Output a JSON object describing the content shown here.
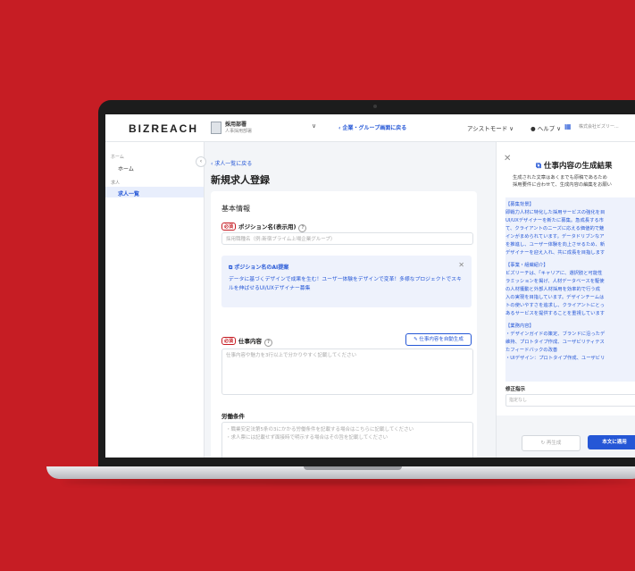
{
  "app": {
    "logo": "BIZREACH"
  },
  "topbar": {
    "company_name": "採用部署",
    "company_sub": "人事採用部署",
    "back_link": "‹ 企業・グループ画面に戻る",
    "assist_mode": "アシストモード ∨",
    "help": "● ヘルプ ∨",
    "corp_name": "株式会社ビズリー..."
  },
  "sidebar": {
    "section_home": "ホーム",
    "item_home": "ホーム",
    "section_jobs": "求人",
    "item_jobs": "求人一覧",
    "collapse_glyph": "‹"
  },
  "main": {
    "breadcrumb": "‹ 求人一覧に戻る",
    "page_title": "新規求人登録",
    "section_title": "基本情報",
    "required_tag": "必須",
    "position_label": "ポジション名(表示用)",
    "position_placeholder": "採用職種名（例:新宿プライム上場企業グループ）",
    "ai_title": "ポジション名のAI提案",
    "ai_body": "データに基づくデザインで成果を生む！ユーザー体験をデザインで変革！多様なプロジェクトでスキルを伸ばせるUI/UXデザイナー募集",
    "jobdesc_label": "仕事内容",
    "jobdesc_placeholder": "仕事内容や魅力を3行以上で分かりやすく記載してください",
    "generate_button": "✎ 仕事内容を自動生成",
    "labor_label": "労働条件",
    "labor_placeholder_1": "・職業安定法第5条の3にかかる労働条件を記載する場合はこちらに記載してください",
    "labor_placeholder_2": "・求人票には記載せず面接時で明示する場合はその旨を記載してください"
  },
  "panel": {
    "title": "仕事内容の生成結果",
    "subtitle_1": "生成された文章はあくまでも原稿であるため",
    "subtitle_2": "採用要件に合わせて、生成内容の編集をお願い",
    "lines": [
      "【募集背景】",
      "即戦力人材に特化した採用サービスの強化を目",
      "UI/UXデザイナーを新たに募集。急成長する市",
      "て、クライアントのニーズに応える価値的で魅",
      "インがまめられています。データドリブンなア",
      "を推進し、ユーザー体験を向上させるため、新",
      "デザイナーを迎え入れ、共に成長を目指します",
      "",
      "【事業・組織紹介】",
      "ビズリーチは、「キャリアに、選択肢と可能性",
      "ラミッションを掲げ、人材データベースを駆使",
      "の人材獲動と外部人材採用を効率的で行う成",
      "入の実現を目指しています。デザインチームは",
      "トの使いやすさを追求し、クライアントにとっ",
      "あるサービスを提供することを重視しています",
      "",
      "【業務内容】",
      "・デザインガイドの策定、ブランドに沿ったデ",
      "維持、プロトタイプ作成、ユーザビリティテス",
      "たフィードバックの改善",
      "・UIデザイン：プロトタイプ作成、ユーザビリ"
    ],
    "fix_label": "修正指示",
    "fix_placeholder": "指定なし",
    "regen_button": "↻ 再生成",
    "apply_button": "本文に適用"
  }
}
